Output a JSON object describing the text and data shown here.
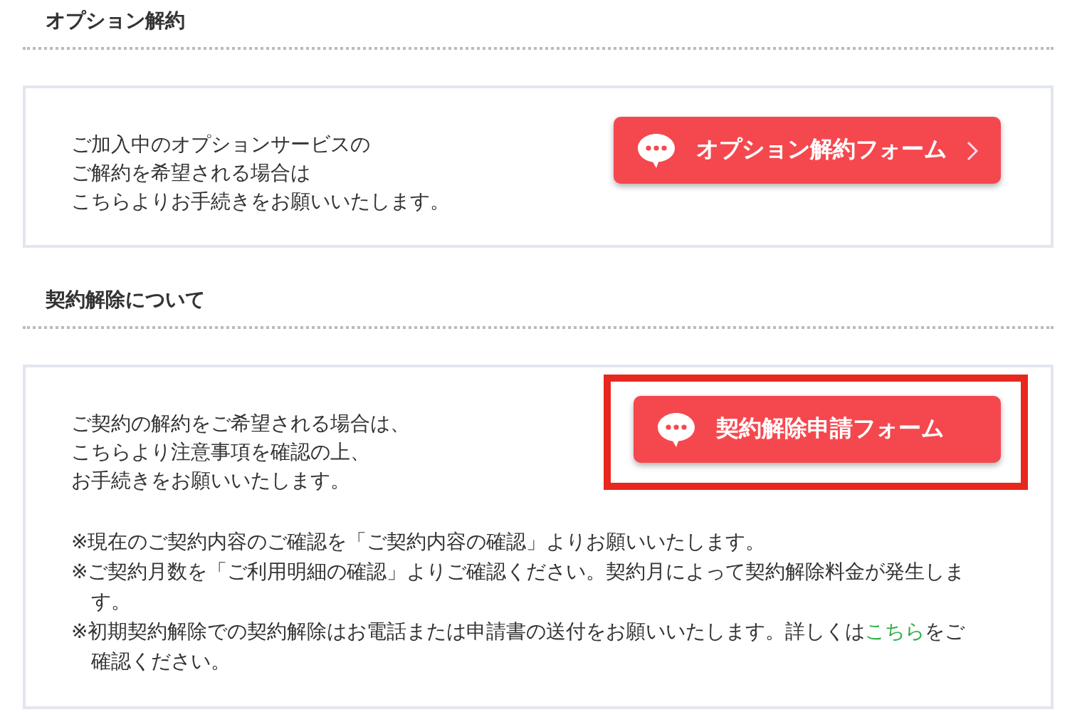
{
  "sections": [
    {
      "heading": "オプション解約",
      "lines": [
        "ご加入中のオプションサービスの",
        "ご解約を希望される場合は",
        "こちらよりお手続きをお願いいたします。"
      ],
      "button": {
        "label": "オプション解約フォーム",
        "chevron": true,
        "highlighted": false
      }
    },
    {
      "heading": "契約解除について",
      "lines": [
        "ご契約の解約をご希望される場合は、",
        "こちらより注意事項を確認の上、",
        "お手続きをお願いいたします。"
      ],
      "button": {
        "label": "契約解除申請フォーム",
        "chevron": false,
        "highlighted": true
      },
      "notes": [
        {
          "text": "※現在のご契約内容のご確認を「ご契約内容の確認」よりお願いいたします。"
        },
        {
          "text": "※ご契約月数を「ご利用明細の確認」よりご確認ください。契約月によって契約解除料金が発生します。"
        },
        {
          "text": "※初期契約解除での契約解除はお電話または申請書の送付をお願いいたします。詳しくは",
          "link": "こちら",
          "after": "をご確認ください。"
        }
      ]
    }
  ]
}
